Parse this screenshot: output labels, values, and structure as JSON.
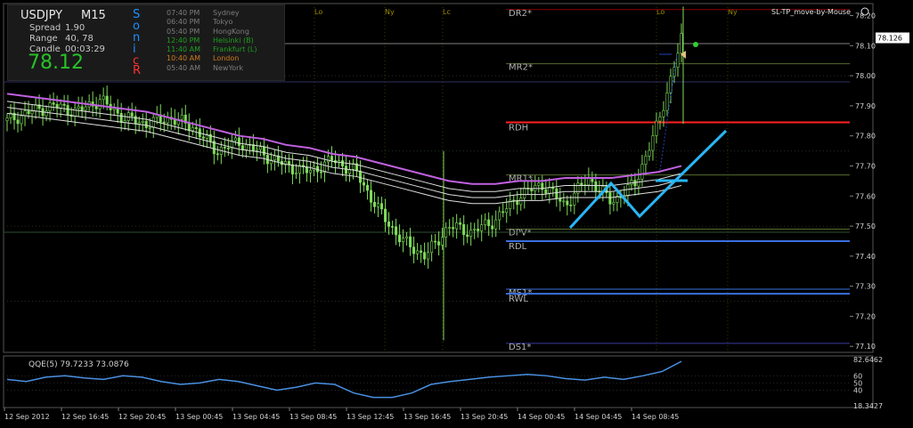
{
  "info_panel": {
    "symbol": "USDJPY",
    "timeframe": "M15",
    "spread_label": "Spread",
    "spread_value": "1.90",
    "range_label": "Range",
    "range_value": "40, 78",
    "candle_label": "Candle",
    "candle_value": "00:03:29",
    "price": "78.12",
    "sonic_letters": [
      "S",
      "o",
      "n",
      "i",
      "c",
      "R"
    ],
    "sessions": [
      {
        "time": "07:40 PM",
        "city": "Sydney",
        "color": "#7d7d7d"
      },
      {
        "time": "06:40 PM",
        "city": "Tokyo",
        "color": "#7d7d7d"
      },
      {
        "time": "05:40 PM",
        "city": "HongKong",
        "color": "#7d7d7d"
      },
      {
        "time": "12:40 PM",
        "city": "Helsinki  (B)",
        "color": "#1f9e1f"
      },
      {
        "time": "11:40 AM",
        "city": "Frankfurt  (L)",
        "color": "#1f9e1f"
      },
      {
        "time": "10:40 AM",
        "city": "London",
        "color": "#c87a20"
      },
      {
        "time": "05:40 AM",
        "city": "NewYork",
        "color": "#7d7d7d"
      }
    ]
  },
  "indicator_title": "SL-TP_move-by-Mouse",
  "session_markers": [
    "Lo",
    "Ny",
    "Lc",
    "Lo",
    "Ny"
  ],
  "current_price_label": "78.126",
  "chart_data": [
    {
      "type": "line",
      "title": "USDJPY M15",
      "ylim": [
        77.08,
        78.24
      ],
      "yticks": [
        "78.20",
        "78.10",
        "78.00",
        "77.90",
        "77.80",
        "77.70",
        "77.60",
        "77.50",
        "77.40",
        "77.30",
        "77.20",
        "77.10"
      ],
      "x_tick_labels": [
        "12 Sep 2012",
        "12 Sep 16:45",
        "12 Sep 20:45",
        "13 Sep 00:45",
        "13 Sep 04:45",
        "13 Sep 08:45",
        "13 Sep 12:45",
        "13 Sep 16:45",
        "13 Sep 20:45",
        "14 Sep 00:45",
        "14 Sep 04:45",
        "14 Sep 08:45"
      ],
      "level_labels": [
        {
          "text": "DR2*",
          "value": 78.22,
          "color": "#8b0000"
        },
        {
          "text": "MR2*",
          "value": 78.04,
          "color": "#556b2f"
        },
        {
          "text": "RDH",
          "value": 77.845,
          "color": "#ff2020"
        },
        {
          "text": "MR1*",
          "value": 77.67,
          "color": "#556b2f"
        },
        {
          "text": "DPV*",
          "value": 77.49,
          "color": "#556b2f"
        },
        {
          "text": "RDL",
          "value": 77.45,
          "color": "#3a6fe0"
        },
        {
          "text": "MS1*",
          "value": 77.29,
          "color": "#3a6fe0"
        },
        {
          "text": "RWL",
          "value": 77.275,
          "color": "#3a6fe0"
        },
        {
          "text": "DS1*",
          "value": 77.11,
          "color": "#3a3aa0"
        }
      ],
      "moving_average": [
        77.9,
        77.89,
        77.88,
        77.87,
        77.86,
        77.85,
        77.84,
        77.82,
        77.8,
        77.78,
        77.76,
        77.75,
        77.73,
        77.72,
        77.7,
        77.69,
        77.67,
        77.65,
        77.63,
        77.61,
        77.6,
        77.6,
        77.61,
        77.61,
        77.62,
        77.62,
        77.62,
        77.63,
        77.64,
        77.66
      ],
      "price_close": [
        77.85,
        77.88,
        77.9,
        77.88,
        77.92,
        77.86,
        77.84,
        77.86,
        77.83,
        77.75,
        77.78,
        77.74,
        77.7,
        77.68,
        77.72,
        77.68,
        77.55,
        77.45,
        77.4,
        77.5,
        77.48,
        77.52,
        77.6,
        77.64,
        77.57,
        77.66,
        77.58,
        77.64,
        77.84,
        78.12
      ]
    },
    {
      "type": "line",
      "title": "QQE(5) 79.7233 73.0876",
      "ylim": [
        18.3427,
        82.6462
      ],
      "yticks": [
        "82.6462",
        "60",
        "50",
        "40",
        "18.3427"
      ],
      "series": [
        {
          "values": [
            55,
            52,
            58,
            60,
            57,
            55,
            60,
            58,
            52,
            48,
            50,
            55,
            52,
            46,
            40,
            44,
            50,
            48,
            36,
            30,
            30,
            36,
            48,
            52,
            55,
            58,
            60,
            62,
            60,
            56,
            54,
            58,
            55,
            60,
            66,
            80
          ]
        }
      ]
    }
  ]
}
